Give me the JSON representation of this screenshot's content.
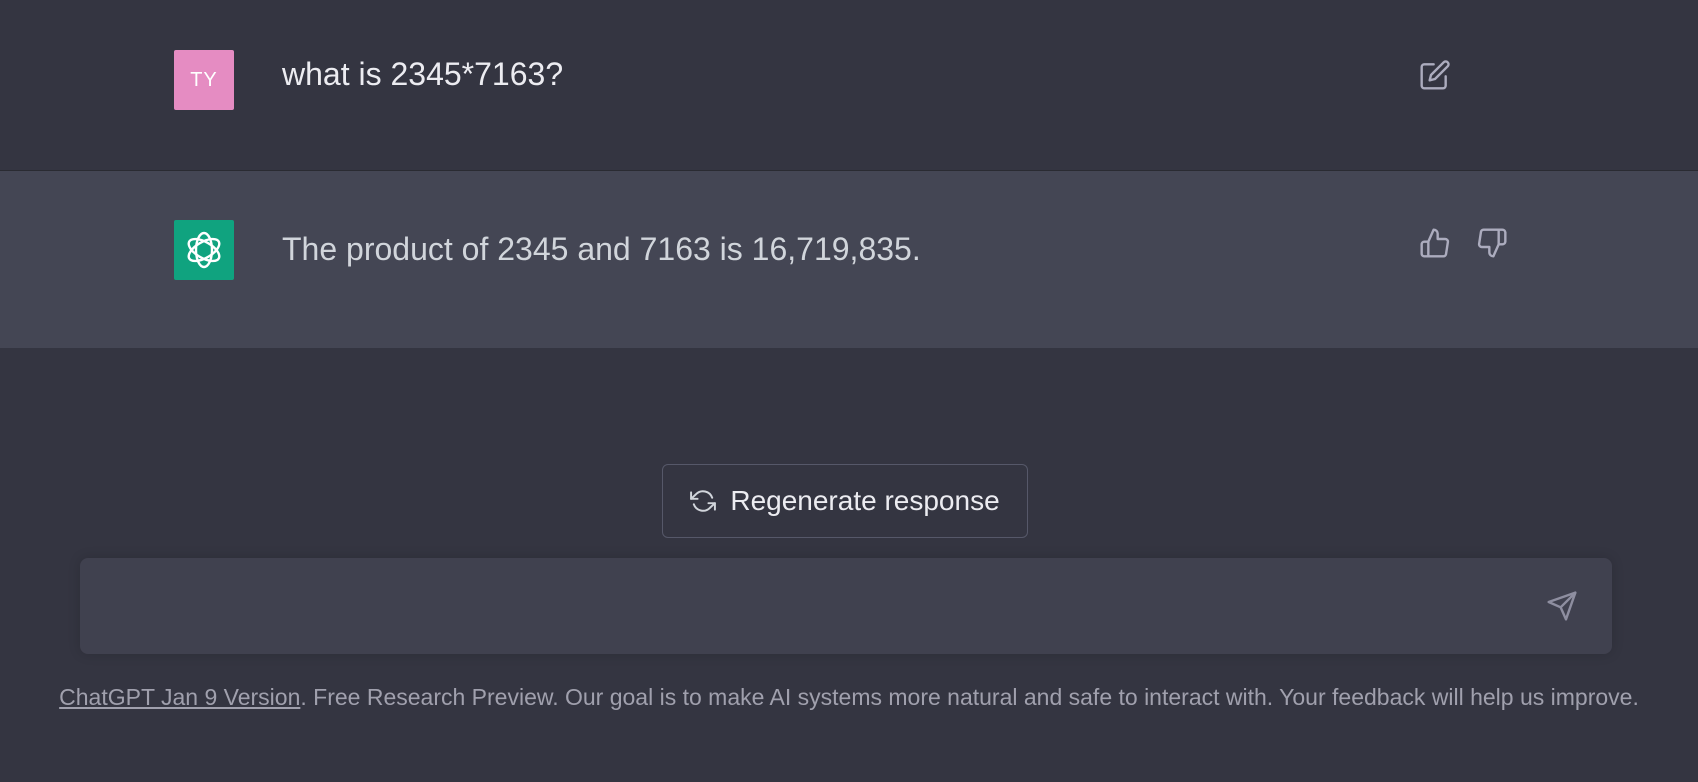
{
  "conversation": {
    "user_message": {
      "avatar_initials": "TY",
      "text": "what is 2345*7163?"
    },
    "assistant_message": {
      "text": "The product of 2345 and 7163 is 16,719,835."
    }
  },
  "regenerate": {
    "label": "Regenerate response"
  },
  "composer": {
    "placeholder": "",
    "value": ""
  },
  "footer": {
    "version_link": "ChatGPT Jan 9 Version",
    "notice": ". Free Research Preview. Our goal is to make AI systems more natural and safe to interact with. Your feedback will help us improve."
  },
  "icons": {
    "edit": "edit-icon",
    "thumbs_up": "thumbs-up-icon",
    "thumbs_down": "thumbs-down-icon",
    "regenerate": "refresh-icon",
    "send": "send-icon",
    "assistant_logo": "openai-logo-icon"
  },
  "colors": {
    "background": "#343541",
    "assistant_row": "#444654",
    "user_avatar": "#e58cc2",
    "assistant_avatar": "#10a37f",
    "input": "#40414f"
  }
}
